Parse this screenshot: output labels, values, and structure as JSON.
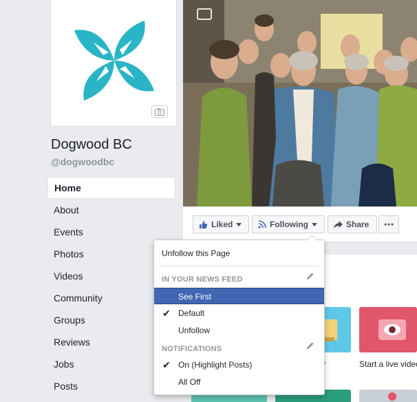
{
  "page": {
    "name": "Dogwood BC",
    "handle": "@dogwoodbc"
  },
  "sidebar": {
    "items": [
      {
        "label": "Home",
        "active": true
      },
      {
        "label": "About"
      },
      {
        "label": "Events"
      },
      {
        "label": "Photos"
      },
      {
        "label": "Videos"
      },
      {
        "label": "Community"
      },
      {
        "label": "Groups"
      },
      {
        "label": "Reviews"
      },
      {
        "label": "Jobs"
      },
      {
        "label": "Posts"
      }
    ]
  },
  "actions": {
    "liked_label": "Liked",
    "following_label": "Following",
    "share_label": "Share"
  },
  "menu": {
    "unfollow_page": "Unfollow this Page",
    "section_news_feed": "IN YOUR NEWS FEED",
    "see_first": "See First",
    "default": "Default",
    "unfollow": "Unfollow",
    "section_notifications": "NOTIFICATIONS",
    "on_highlight": "On (Highlight Posts)",
    "all_off": "All Off"
  },
  "content": {
    "live_video_caption": "Start a live video",
    "left_caption_fragment": "r"
  },
  "colors": {
    "brand_teal": "#2ab5c6",
    "facebook_blue": "#4267b2",
    "background": "#e9ebee"
  }
}
